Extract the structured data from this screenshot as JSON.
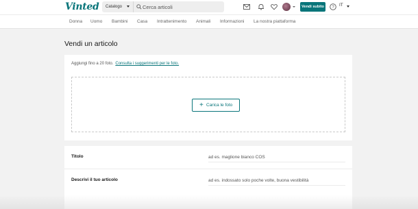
{
  "header": {
    "logo": "Vinted",
    "catalog_label": "Catalogo",
    "search_placeholder": "Cerca articoli",
    "sell_button": "Vendi subito",
    "language": "IT",
    "icons": [
      "mail-icon",
      "bell-icon",
      "heart-icon",
      "help-icon"
    ]
  },
  "nav": {
    "categories": [
      "Donna",
      "Uomo",
      "Bambini",
      "Casa",
      "Intrattenimento",
      "Animali",
      "Informazioni",
      "La nostra piattaforma"
    ]
  },
  "page": {
    "title": "Vendi un articolo"
  },
  "upload": {
    "hint": "Aggiungi fino a 20 foto.",
    "hint_link": "Consulta i suggerimenti per le foto.",
    "button": "Carica le foto"
  },
  "form": {
    "title_label": "Titolo",
    "title_placeholder": "ad es. maglione bianco COS",
    "desc_label": "Descrivi il tuo articolo",
    "desc_placeholder": "ad es. indossato solo poche volte, buona vestibilità"
  },
  "colors": {
    "brand": "#09757a",
    "background": "#f2f2f2"
  }
}
